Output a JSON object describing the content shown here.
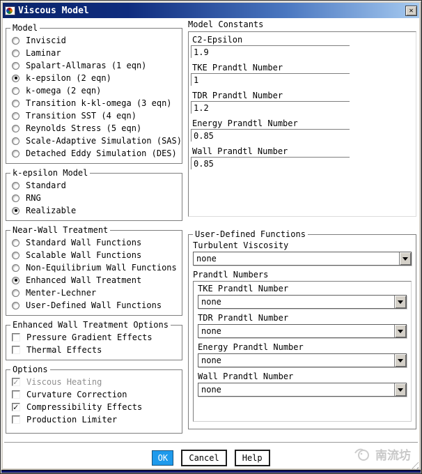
{
  "window": {
    "title": "Viscous Model",
    "close_glyph": "✕"
  },
  "colors": {
    "titlebar_left": "#0a246a",
    "titlebar_right": "#a6caf0",
    "ok_button": "#1e9aec",
    "disabled_text": "#8f8f8f"
  },
  "left": {
    "model_group": {
      "label": "Model",
      "options": [
        {
          "label": "Inviscid",
          "selected": false
        },
        {
          "label": "Laminar",
          "selected": false
        },
        {
          "label": "Spalart-Allmaras (1 eqn)",
          "selected": false
        },
        {
          "label": "k-epsilon (2 eqn)",
          "selected": true
        },
        {
          "label": "k-omega (2 eqn)",
          "selected": false
        },
        {
          "label": "Transition k-kl-omega (3 eqn)",
          "selected": false
        },
        {
          "label": "Transition SST (4 eqn)",
          "selected": false
        },
        {
          "label": "Reynolds Stress (5 eqn)",
          "selected": false
        },
        {
          "label": "Scale-Adaptive Simulation (SAS)",
          "selected": false
        },
        {
          "label": "Detached Eddy Simulation (DES)",
          "selected": false
        }
      ]
    },
    "kepsilon_group": {
      "label": "k-epsilon Model",
      "options": [
        {
          "label": "Standard",
          "selected": false
        },
        {
          "label": "RNG",
          "selected": false
        },
        {
          "label": "Realizable",
          "selected": true
        }
      ]
    },
    "near_wall_group": {
      "label": "Near-Wall Treatment",
      "options": [
        {
          "label": "Standard Wall Functions",
          "selected": false
        },
        {
          "label": "Scalable Wall Functions",
          "selected": false
        },
        {
          "label": "Non-Equilibrium Wall Functions",
          "selected": false
        },
        {
          "label": "Enhanced Wall Treatment",
          "selected": true
        },
        {
          "label": "Menter-Lechner",
          "selected": false
        },
        {
          "label": "User-Defined Wall Functions",
          "selected": false
        }
      ]
    },
    "ewt_options_group": {
      "label": "Enhanced Wall Treatment Options",
      "options": [
        {
          "label": "Pressure Gradient Effects",
          "checked": false,
          "disabled": false
        },
        {
          "label": "Thermal Effects",
          "checked": false,
          "disabled": false
        }
      ]
    },
    "options_group": {
      "label": "Options",
      "options": [
        {
          "label": "Viscous Heating",
          "checked": true,
          "disabled": true
        },
        {
          "label": "Curvature Correction",
          "checked": false,
          "disabled": false
        },
        {
          "label": "Compressibility Effects",
          "checked": true,
          "disabled": false
        },
        {
          "label": "Production Limiter",
          "checked": false,
          "disabled": false
        }
      ]
    }
  },
  "right": {
    "model_constants": {
      "label": "Model Constants",
      "fields": [
        {
          "label": "C2-Epsilon",
          "value": "1.9"
        },
        {
          "label": "TKE Prandtl Number",
          "value": "1"
        },
        {
          "label": "TDR Prandtl Number",
          "value": "1.2"
        },
        {
          "label": "Energy Prandtl Number",
          "value": "0.85"
        },
        {
          "label": "Wall Prandtl Number",
          "value": "0.85"
        }
      ]
    },
    "udf_group": {
      "label": "User-Defined Functions",
      "turbulent_viscosity": {
        "label": "Turbulent Viscosity",
        "value": "none"
      },
      "prandtl_numbers": {
        "label": "Prandtl Numbers",
        "items": [
          {
            "label": "TKE Prandtl Number",
            "value": "none"
          },
          {
            "label": "TDR Prandtl Number",
            "value": "none"
          },
          {
            "label": "Energy Prandtl Number",
            "value": "none"
          },
          {
            "label": "Wall Prandtl Number",
            "value": "none"
          }
        ]
      }
    }
  },
  "footer": {
    "ok_label": "OK",
    "cancel_label": "Cancel",
    "help_label": "Help",
    "watermark_text": "南流坊"
  }
}
